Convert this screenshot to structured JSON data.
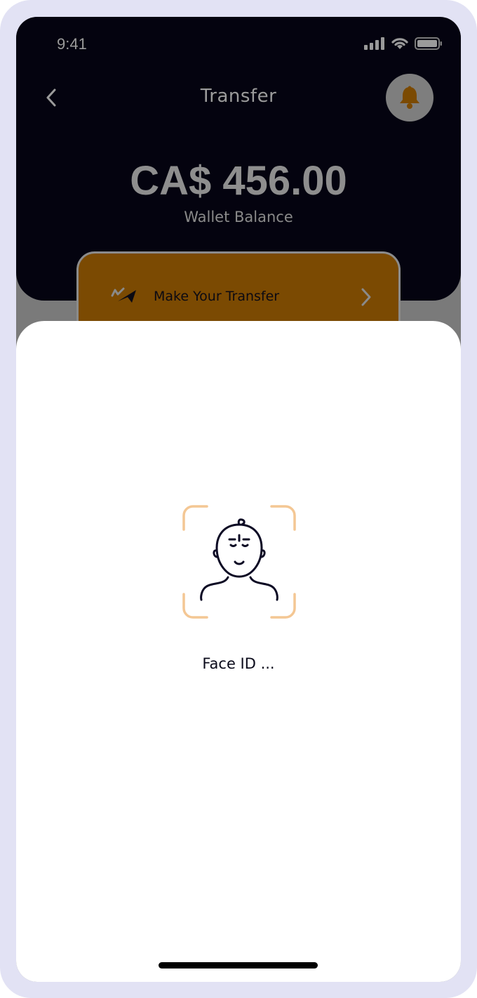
{
  "status_bar": {
    "time": "9:41",
    "icons": [
      "signal-icon",
      "wifi-icon",
      "battery-icon"
    ]
  },
  "header": {
    "back_icon": "chevron-left-icon",
    "title": "Transfer",
    "notification_icon": "bell-icon"
  },
  "wallet": {
    "amount": "CA$ 456.00",
    "label": "Wallet Balance"
  },
  "transfer_card": {
    "icon": "transfer-arrows-icon",
    "label": "Make Your Transfer",
    "chevron_icon": "chevron-right-icon"
  },
  "face_id": {
    "icon": "face-scan-icon",
    "label": "Face ID ..."
  },
  "colors": {
    "header_bg": "#04030f",
    "accent_brown": "#7b4a02",
    "face_frame": "#f4c794",
    "frame_bg": "#e2e2f4"
  }
}
